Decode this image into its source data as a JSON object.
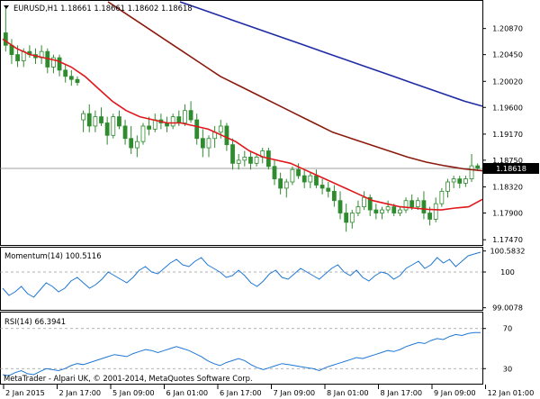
{
  "chart_data": [
    {
      "type": "candlestick",
      "title": "EURUSD,H1  1.18661 1.18661 1.18602 1.18618",
      "current_price": "1.18618",
      "y_ticks": [
        "1.20870",
        "1.20450",
        "1.20020",
        "1.19600",
        "1.19170",
        "1.18750",
        "1.18320",
        "1.17900",
        "1.17470"
      ],
      "ylim": [
        1.174,
        1.213
      ],
      "colors": {
        "candle": "#2e8b2e",
        "fast_ma": "#e0171c",
        "slow_ma": "#8b1a0e",
        "long_ma": "#1f2aa5",
        "current_line": "#808080"
      },
      "candles": [
        [
          1.208,
          1.212,
          1.205,
          1.206
        ],
        [
          1.206,
          1.207,
          1.203,
          1.2045
        ],
        [
          1.2045,
          1.206,
          1.2025,
          1.2035
        ],
        [
          1.2035,
          1.2055,
          1.2025,
          1.205
        ],
        [
          1.205,
          1.206,
          1.204,
          1.2045
        ],
        [
          1.2045,
          1.2055,
          1.203,
          1.204
        ],
        [
          1.204,
          1.206,
          1.203,
          1.205
        ],
        [
          1.205,
          1.2055,
          1.2015,
          1.2025
        ],
        [
          1.2025,
          1.2045,
          1.2015,
          1.204
        ],
        [
          1.204,
          1.2045,
          1.201,
          1.202
        ],
        [
          1.202,
          1.203,
          1.2,
          1.201
        ],
        [
          1.201,
          1.202,
          1.1995,
          1.2005
        ],
        [
          1.2005,
          1.201,
          1.1995,
          1.2
        ],
        [
          1.194,
          1.1955,
          1.192,
          1.195
        ],
        [
          1.195,
          1.1965,
          1.192,
          1.193
        ],
        [
          1.193,
          1.1955,
          1.192,
          1.1945
        ],
        [
          1.1945,
          1.196,
          1.193,
          1.1935
        ],
        [
          1.1935,
          1.1945,
          1.19,
          1.1915
        ],
        [
          1.1915,
          1.195,
          1.191,
          1.1945
        ],
        [
          1.1945,
          1.1955,
          1.1925,
          1.193
        ],
        [
          1.193,
          1.194,
          1.19,
          1.191
        ],
        [
          1.191,
          1.193,
          1.1885,
          1.1895
        ],
        [
          1.1895,
          1.1915,
          1.188,
          1.1905
        ],
        [
          1.1905,
          1.1935,
          1.19,
          1.193
        ],
        [
          1.193,
          1.1945,
          1.1915,
          1.1925
        ],
        [
          1.1925,
          1.195,
          1.192,
          1.194
        ],
        [
          1.194,
          1.195,
          1.1925,
          1.1935
        ],
        [
          1.1935,
          1.1945,
          1.192,
          1.193
        ],
        [
          1.193,
          1.195,
          1.1925,
          1.1945
        ],
        [
          1.1945,
          1.1955,
          1.193,
          1.1935
        ],
        [
          1.1935,
          1.1965,
          1.193,
          1.1955
        ],
        [
          1.1955,
          1.197,
          1.1935,
          1.194
        ],
        [
          1.194,
          1.195,
          1.19,
          1.191
        ],
        [
          1.191,
          1.1925,
          1.188,
          1.1895
        ],
        [
          1.1895,
          1.1915,
          1.188,
          1.191
        ],
        [
          1.191,
          1.193,
          1.1895,
          1.192
        ],
        [
          1.192,
          1.194,
          1.191,
          1.193
        ],
        [
          1.193,
          1.1935,
          1.189,
          1.19
        ],
        [
          1.19,
          1.191,
          1.186,
          1.187
        ],
        [
          1.187,
          1.1885,
          1.186,
          1.1875
        ],
        [
          1.1875,
          1.189,
          1.1865,
          1.188
        ],
        [
          1.188,
          1.189,
          1.186,
          1.187
        ],
        [
          1.187,
          1.1885,
          1.1865,
          1.188
        ],
        [
          1.188,
          1.1895,
          1.187,
          1.189
        ],
        [
          1.189,
          1.1895,
          1.186,
          1.1865
        ],
        [
          1.1865,
          1.1875,
          1.1835,
          1.1845
        ],
        [
          1.1845,
          1.1855,
          1.182,
          1.183
        ],
        [
          1.183,
          1.1845,
          1.1815,
          1.184
        ],
        [
          1.184,
          1.1865,
          1.1835,
          1.186
        ],
        [
          1.186,
          1.187,
          1.1845,
          1.185
        ],
        [
          1.185,
          1.186,
          1.183,
          1.184
        ],
        [
          1.184,
          1.1855,
          1.183,
          1.185
        ],
        [
          1.185,
          1.186,
          1.183,
          1.1835
        ],
        [
          1.1835,
          1.1845,
          1.182,
          1.183
        ],
        [
          1.183,
          1.184,
          1.1815,
          1.1825
        ],
        [
          1.1825,
          1.1835,
          1.18,
          1.181
        ],
        [
          1.181,
          1.1825,
          1.178,
          1.179
        ],
        [
          1.179,
          1.1805,
          1.176,
          1.1775
        ],
        [
          1.1775,
          1.1795,
          1.1765,
          1.179
        ],
        [
          1.179,
          1.181,
          1.1785,
          1.18
        ],
        [
          1.18,
          1.1825,
          1.1795,
          1.1815
        ],
        [
          1.1815,
          1.182,
          1.1785,
          1.1795
        ],
        [
          1.1795,
          1.1805,
          1.178,
          1.179
        ],
        [
          1.179,
          1.18,
          1.178,
          1.1795
        ],
        [
          1.1795,
          1.181,
          1.179,
          1.18
        ],
        [
          1.18,
          1.1805,
          1.1785,
          1.179
        ],
        [
          1.179,
          1.18,
          1.1785,
          1.1795
        ],
        [
          1.1795,
          1.1815,
          1.179,
          1.181
        ],
        [
          1.181,
          1.182,
          1.1795,
          1.18
        ],
        [
          1.18,
          1.1815,
          1.1795,
          1.181
        ],
        [
          1.181,
          1.1825,
          1.178,
          1.179
        ],
        [
          1.179,
          1.18,
          1.177,
          1.178
        ],
        [
          1.178,
          1.1815,
          1.1775,
          1.1805
        ],
        [
          1.1805,
          1.183,
          1.18,
          1.1825
        ],
        [
          1.1825,
          1.1845,
          1.1815,
          1.184
        ],
        [
          1.184,
          1.185,
          1.183,
          1.1845
        ],
        [
          1.1845,
          1.185,
          1.183,
          1.1838
        ],
        [
          1.1838,
          1.185,
          1.1832,
          1.1845
        ],
        [
          1.1845,
          1.1885,
          1.184,
          1.1866
        ],
        [
          1.1866,
          1.187,
          1.1858,
          1.1862
        ]
      ],
      "fast_ma": [
        1.207,
        1.2055,
        1.2045,
        1.204,
        1.2035,
        1.2025,
        1.201,
        1.199,
        1.197,
        1.1955,
        1.1945,
        1.194,
        1.1935,
        1.1935,
        1.193,
        1.1925,
        1.1915,
        1.1905,
        1.189,
        1.188,
        1.1875,
        1.187,
        1.186,
        1.185,
        1.184,
        1.183,
        1.182,
        1.181,
        1.1805,
        1.18,
        1.1798,
        1.1796,
        1.1795,
        1.1798,
        1.18,
        1.1812
      ],
      "slow_ma": [
        1.213,
        1.211,
        1.209,
        1.207,
        1.205,
        1.203,
        1.201,
        1.1995,
        1.198,
        1.1965,
        1.195,
        1.1935,
        1.192,
        1.191,
        1.19,
        1.189,
        1.188,
        1.1872,
        1.1866,
        1.1861,
        1.1858
      ],
      "long_ma": [
        1.213,
        1.212,
        1.211,
        1.21,
        1.209,
        1.208,
        1.207,
        1.206,
        1.205,
        1.204,
        1.203,
        1.202,
        1.201,
        1.2,
        1.199,
        1.198,
        1.197,
        1.1962
      ],
      "x_labels": [
        "2 Jan 2015",
        "2 Jan 17:00",
        "5 Jan 09:00",
        "6 Jan 01:00",
        "6 Jan 17:00",
        "7 Jan 09:00",
        "8 Jan 01:00",
        "8 Jan 17:00",
        "9 Jan 09:00",
        "12 Jan 01:00"
      ]
    },
    {
      "type": "line",
      "title": "Momentum(14) 100.5116",
      "y_ticks": [
        "100.5832",
        "100",
        "99.0078"
      ],
      "ylim": [
        98.95,
        100.65
      ],
      "level_line": 100,
      "color": "#1f77d4",
      "values": [
        99.55,
        99.35,
        99.45,
        99.6,
        99.4,
        99.3,
        99.5,
        99.7,
        99.6,
        99.45,
        99.55,
        99.75,
        99.85,
        99.7,
        99.55,
        99.65,
        99.8,
        100.0,
        99.9,
        99.8,
        99.7,
        99.85,
        100.05,
        100.15,
        100.0,
        99.95,
        100.1,
        100.25,
        100.35,
        100.2,
        100.15,
        100.3,
        100.4,
        100.2,
        100.1,
        100.0,
        99.85,
        99.9,
        100.05,
        99.9,
        99.7,
        99.6,
        99.75,
        99.95,
        100.05,
        99.85,
        99.8,
        99.95,
        100.1,
        100.0,
        99.9,
        99.8,
        99.95,
        100.1,
        100.2,
        100.0,
        99.9,
        100.05,
        99.85,
        99.75,
        99.9,
        100.0,
        99.95,
        99.8,
        99.9,
        100.1,
        100.2,
        100.3,
        100.1,
        100.2,
        100.4,
        100.25,
        100.35,
        100.15,
        100.3,
        100.45,
        100.5,
        100.55
      ]
    },
    {
      "type": "line",
      "title": "RSI(14) 66.3941",
      "y_ticks": [
        "70",
        "30"
      ],
      "ylim": [
        15,
        85
      ],
      "levels": [
        70,
        30
      ],
      "color": "#1f77d4",
      "values": [
        24,
        23,
        26,
        28,
        25,
        24,
        27,
        30,
        29,
        28,
        30,
        33,
        35,
        34,
        36,
        38,
        40,
        42,
        44,
        43,
        42,
        45,
        47,
        49,
        48,
        46,
        48,
        50,
        52,
        50,
        48,
        45,
        42,
        38,
        35,
        33,
        36,
        38,
        40,
        38,
        34,
        31,
        29,
        31,
        33,
        35,
        34,
        33,
        32,
        31,
        30,
        28,
        31,
        33,
        35,
        37,
        39,
        41,
        40,
        42,
        44,
        46,
        48,
        47,
        49,
        52,
        54,
        56,
        55,
        58,
        60,
        59,
        62,
        64,
        63,
        65,
        66,
        66
      ]
    },
    {
      "type": "text",
      "copyright": "MetaTrader - Alpari UK, © 2001-2014, MetaQuotes Software Corp."
    }
  ]
}
